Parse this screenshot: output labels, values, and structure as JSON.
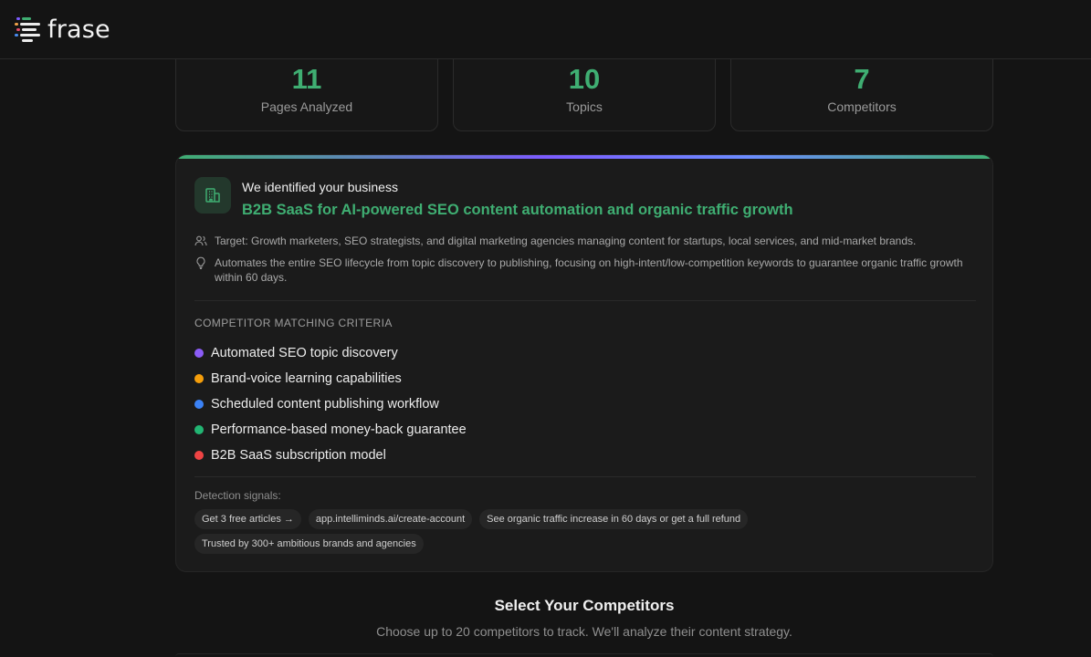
{
  "brand": {
    "logo_text": "frase"
  },
  "stats": [
    {
      "value": "11",
      "label": "Pages Analyzed"
    },
    {
      "value": "10",
      "label": "Topics"
    },
    {
      "value": "7",
      "label": "Competitors"
    }
  ],
  "business": {
    "kicker": "We identified your business",
    "title": "B2B SaaS for AI-powered SEO content automation and organic traffic growth",
    "target": "Target: Growth marketers, SEO strategists, and digital marketing agencies managing content for startups, local services, and mid-market brands.",
    "value_prop": "Automates the entire SEO lifecycle from topic discovery to publishing, focusing on high-intent/low-competition keywords to guarantee organic traffic growth within 60 days."
  },
  "criteria": {
    "heading": "COMPETITOR MATCHING CRITERIA",
    "items": [
      {
        "label": "Automated SEO topic discovery",
        "color": "#8b5cf6"
      },
      {
        "label": "Brand-voice learning capabilities",
        "color": "#f59e0b"
      },
      {
        "label": "Scheduled content publishing workflow",
        "color": "#3b82f6"
      },
      {
        "label": "Performance-based money-back guarantee",
        "color": "#22b573"
      },
      {
        "label": "B2B SaaS subscription model",
        "color": "#ef4444"
      }
    ]
  },
  "signals": {
    "heading": "Detection signals:",
    "chips": [
      "Get 3 free articles →",
      "app.intelliminds.ai/create-account",
      "See organic traffic increase in 60 days or get a full refund",
      "Trusted by 300+ ambitious brands and agencies"
    ]
  },
  "select": {
    "title": "Select Your Competitors",
    "subtitle": "Choose up to 20 competitors to track. We'll analyze their content strategy."
  },
  "colors": {
    "accent": "#3fae72",
    "background": "#141414",
    "card": "#1b1b1b"
  }
}
